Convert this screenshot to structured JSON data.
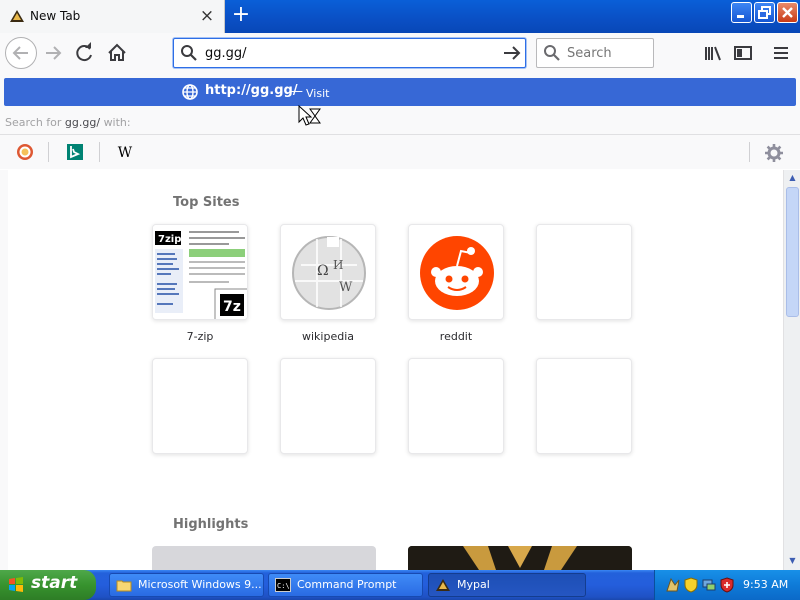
{
  "browser": {
    "tab_title": "New Tab",
    "url_input": "gg.gg/",
    "search_placeholder": "Search"
  },
  "dropdown": {
    "result_url": "http://gg.gg/",
    "result_dash": "—",
    "result_action": "Visit",
    "search_for_prefix": "Search for",
    "search_for_term": "gg.gg/",
    "search_for_suffix": "with:",
    "engines": [
      "DuckDuckGo",
      "Bing",
      "Wikipedia"
    ]
  },
  "newtab": {
    "top_sites_heading": "Top Sites",
    "top_sites": [
      {
        "label": "7-zip"
      },
      {
        "label": "wikipedia"
      },
      {
        "label": "reddit"
      },
      {
        "label": ""
      }
    ],
    "highlights_heading": "Highlights"
  },
  "taskbar": {
    "start_label": "start",
    "tasks": [
      {
        "label": "Microsoft Windows 9..."
      },
      {
        "label": "Command Prompt"
      },
      {
        "label": "Mypal"
      }
    ],
    "clock": "9:53 AM"
  },
  "colors": {
    "accent": "#3768d6",
    "reddit": "#ff4500",
    "xp_blue": "#245edc",
    "start_green": "#37932e"
  }
}
